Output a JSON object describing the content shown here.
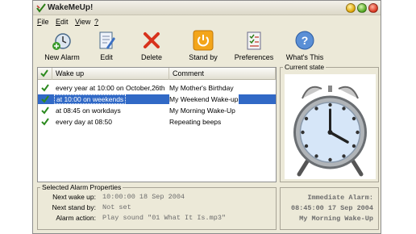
{
  "app": {
    "title": "WakeMeUp!"
  },
  "menu": {
    "items": [
      {
        "underline": "F",
        "rest": "ile"
      },
      {
        "underline": "E",
        "rest": "dit"
      },
      {
        "underline": "V",
        "rest": "iew"
      },
      {
        "underline": "?",
        "rest": ""
      }
    ]
  },
  "toolbar": {
    "buttons": [
      {
        "label": "New Alarm",
        "icon": "new-alarm-icon"
      },
      {
        "label": "Edit",
        "icon": "edit-icon"
      },
      {
        "label": "Delete",
        "icon": "delete-icon"
      },
      {
        "label": "Stand by",
        "icon": "standby-icon"
      },
      {
        "label": "Preferences",
        "icon": "preferences-icon"
      },
      {
        "label": "What's This",
        "icon": "help-icon"
      }
    ]
  },
  "alarm_list": {
    "columns": [
      "Wake up",
      "Comment"
    ],
    "rows": [
      {
        "wake": "every year at 10:00 on October,26th",
        "comment": "My Mother's Birthday",
        "checked": true,
        "selected": false
      },
      {
        "wake": "at 10:00 on weekends",
        "comment": "My Weekend Wake-up",
        "checked": true,
        "selected": true
      },
      {
        "wake": "at 08:45 on workdays",
        "comment": "My Morning Wake-Up",
        "checked": true,
        "selected": false
      },
      {
        "wake": "every day at 08:50",
        "comment": "Repeating beeps",
        "checked": true,
        "selected": false
      }
    ]
  },
  "current_state": {
    "label": "Current state",
    "clock_icon": "alarm-clock-icon",
    "time_shown": "16:00"
  },
  "selected_props": {
    "label": "Selected Alarm Properties",
    "next_wake_label": "Next wake up:",
    "next_wake_value": "10:00:00 18 Sep 2004",
    "next_standby_label": "Next stand by:",
    "next_standby_value": "Not set",
    "action_label": "Alarm action:",
    "action_value": "Play sound \"01 What It Is.mp3\""
  },
  "immediate": {
    "line1": "Immediate Alarm:",
    "line2": "08:45:00 17 Sep 2004",
    "line3": "My Morning Wake-Up"
  },
  "colors": {
    "selection": "#3169c6",
    "window_bg": "#ece9d8",
    "value_text": "#6c6c6c"
  }
}
